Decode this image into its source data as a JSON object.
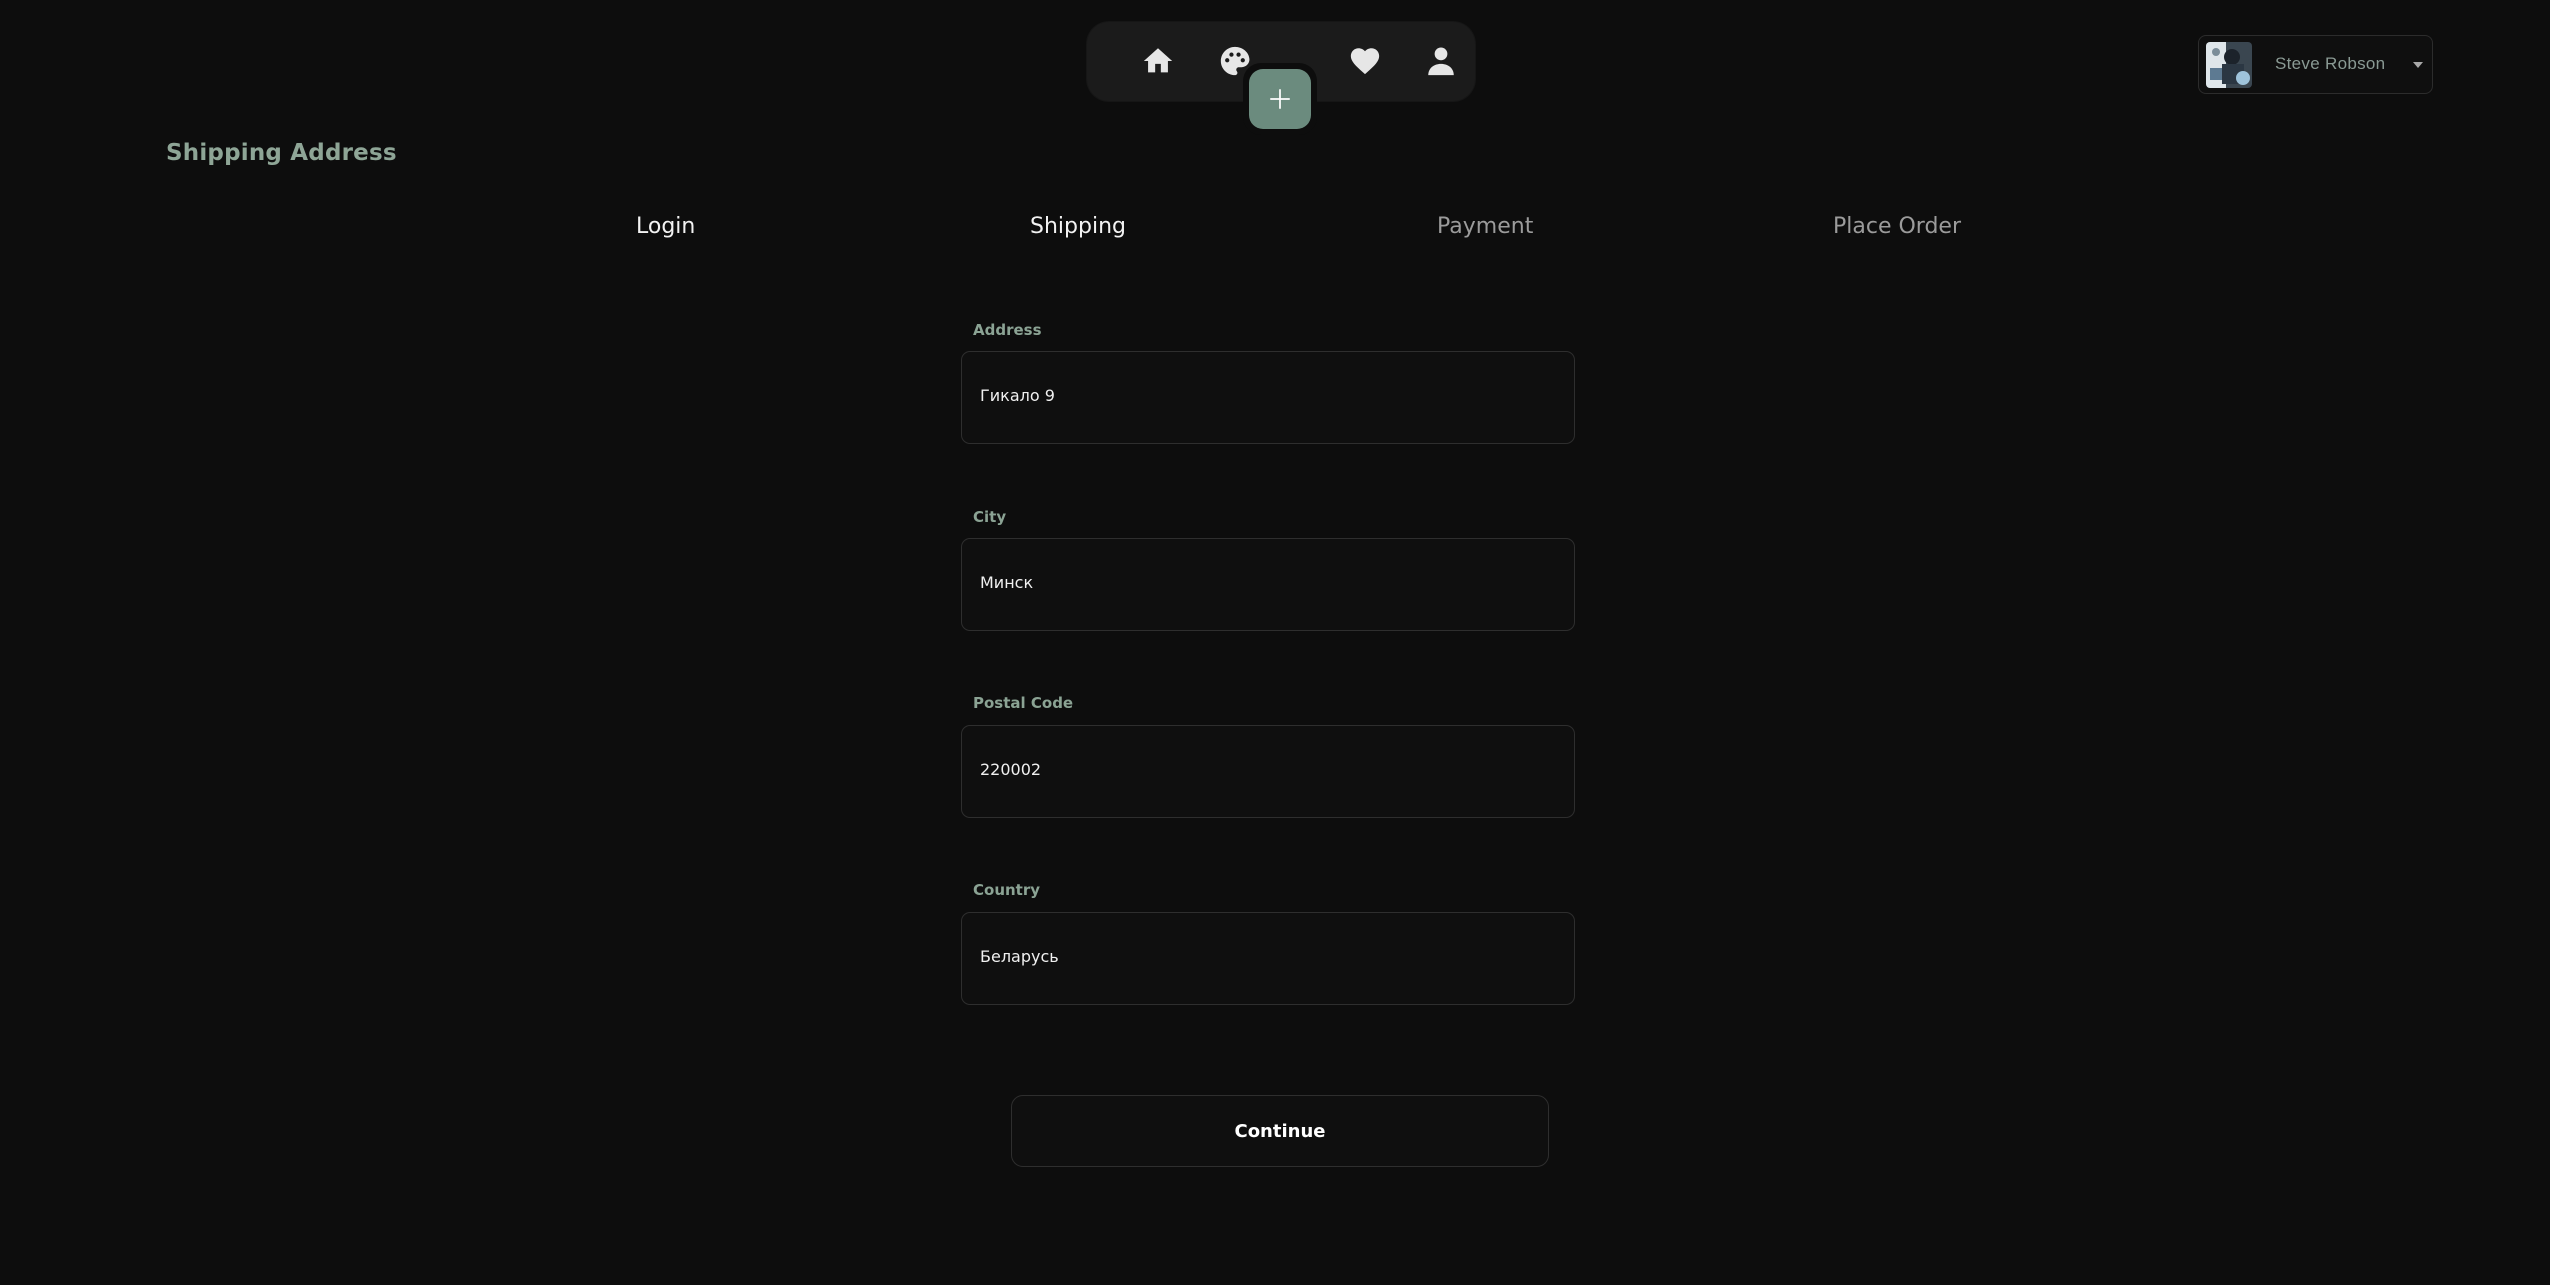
{
  "nav": {
    "items": [
      {
        "icon": "home-icon"
      },
      {
        "icon": "palette-icon"
      },
      {
        "icon": "plus-icon"
      },
      {
        "icon": "heart-icon"
      },
      {
        "icon": "user-icon"
      }
    ],
    "accent": "#6b8b7e"
  },
  "user": {
    "name": "Steve Robson"
  },
  "page": {
    "title": "Shipping Address"
  },
  "steps": [
    {
      "label": "Login",
      "active": true
    },
    {
      "label": "Shipping",
      "active": true
    },
    {
      "label": "Payment",
      "active": false
    },
    {
      "label": "Place Order",
      "active": false
    }
  ],
  "form": {
    "address": {
      "label": "Address",
      "value": "Гикало 9"
    },
    "city": {
      "label": "City",
      "value": "Минск"
    },
    "postal_code": {
      "label": "Postal Code",
      "value": "220002"
    },
    "country": {
      "label": "Country",
      "value": "Беларусь"
    },
    "submit_label": "Continue"
  }
}
